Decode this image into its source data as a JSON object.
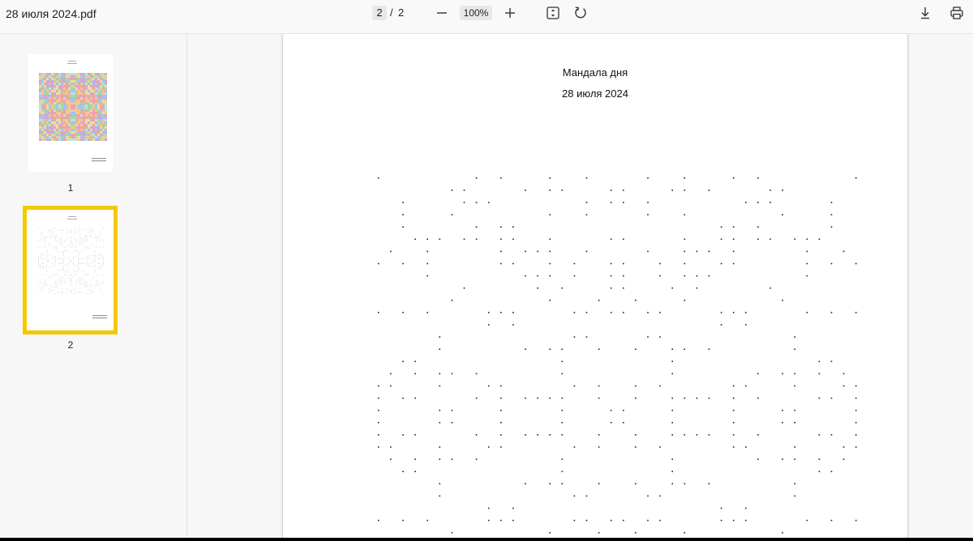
{
  "toolbar": {
    "title": "28 июля 2024.pdf",
    "current_page": "2",
    "separator": "/",
    "total_pages": "2",
    "zoom": "100%",
    "icons": {
      "zoom_out": "minus-icon",
      "zoom_in": "plus-icon",
      "fit": "fit-page-icon",
      "rotate": "rotate-icon",
      "download": "download-icon",
      "print": "print-icon"
    }
  },
  "sidebar": {
    "thumbnails": [
      {
        "label": "1",
        "selected": false
      },
      {
        "label": "2",
        "selected": true
      }
    ],
    "selection_color": "#f6c800"
  },
  "document": {
    "heading": "Мандала дня",
    "date": "28 июля 2024"
  },
  "colors": {
    "mandala_palette": [
      "#e9a0c4",
      "#a8d8a0",
      "#f2c98a",
      "#9fc6ef",
      "#c8a8e8",
      "#f4a49a",
      "#b8e4e0",
      "#f0e08c"
    ]
  }
}
